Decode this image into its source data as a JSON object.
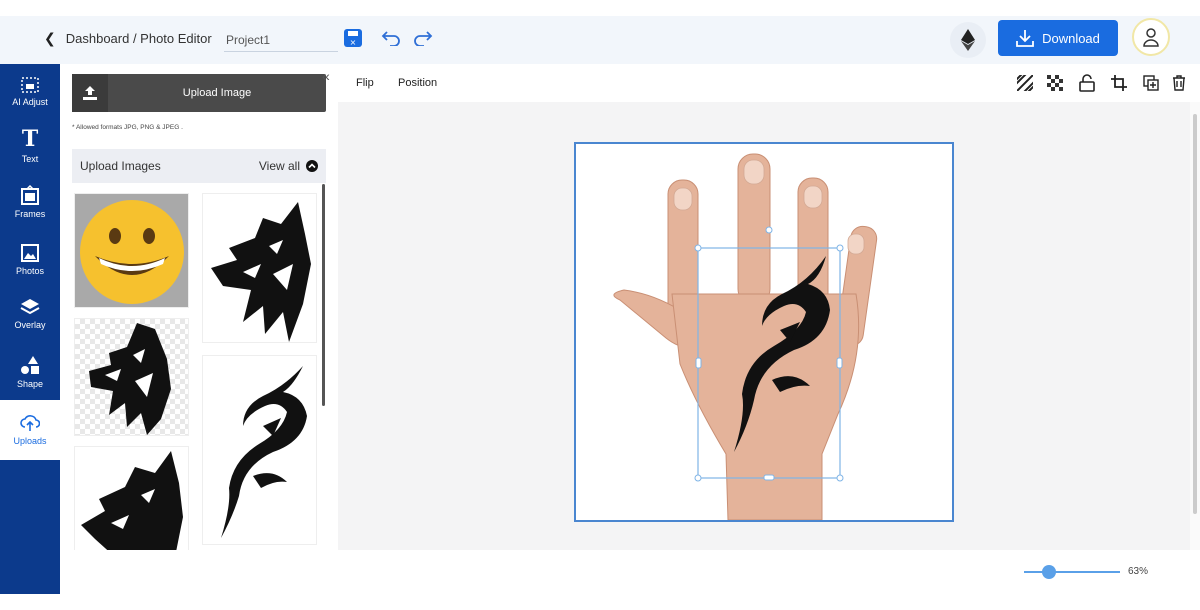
{
  "header": {
    "breadcrumb": "Dashboard / Photo Editor",
    "project_name": "Project1",
    "download_label": "Download"
  },
  "rail": {
    "items": [
      {
        "label": "AI Adjust",
        "icon": "ai-adjust-icon"
      },
      {
        "label": "Text",
        "icon": "text-icon"
      },
      {
        "label": "Frames",
        "icon": "frames-icon"
      },
      {
        "label": "Photos",
        "icon": "photos-icon"
      },
      {
        "label": "Overlay",
        "icon": "overlay-icon"
      },
      {
        "label": "Shape",
        "icon": "shape-icon"
      },
      {
        "label": "Uploads",
        "icon": "upload-cloud-icon",
        "active": true
      }
    ]
  },
  "panel": {
    "upload_button": "Upload Image",
    "formats_note": "* Allowed formats JPG, PNG & JPEG .",
    "section_title": "Upload Images",
    "view_all": "View all"
  },
  "canvas_toolbar": {
    "flip": "Flip",
    "position": "Position"
  },
  "zoom": {
    "value_label": "63%",
    "level": 0.63
  },
  "colors": {
    "rail_bg": "#0c3a8c",
    "accent": "#1a6ce0",
    "artboard_border": "#4a86d0"
  }
}
